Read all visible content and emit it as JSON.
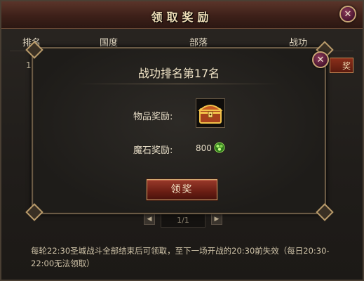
{
  "window": {
    "title": "领取奖励",
    "close": "✕"
  },
  "table": {
    "columns": [
      "排名",
      "国度",
      "部落",
      "战功"
    ],
    "row_rank_partial": "1",
    "row_claim_partial": "奖"
  },
  "pager": {
    "prev": "◀",
    "page": "1/1",
    "next": "▶"
  },
  "notice": "每轮22:30圣城战斗全部结束后可领取，至下一场开战的20:30前失效（每日20:30-22:00无法领取）",
  "modal": {
    "title": "战功排名第17名",
    "close": "✕",
    "item_reward_label": "物品奖励:",
    "stone_reward_label": "魔石奖励:",
    "stone_amount": "800",
    "claim_button": "领奖",
    "item_icon": "treasure-chest-icon",
    "stone_icon": "green-gem-icon"
  },
  "colors": {
    "accent_red": "#8a2f1a",
    "gold_border": "#c9a676"
  }
}
